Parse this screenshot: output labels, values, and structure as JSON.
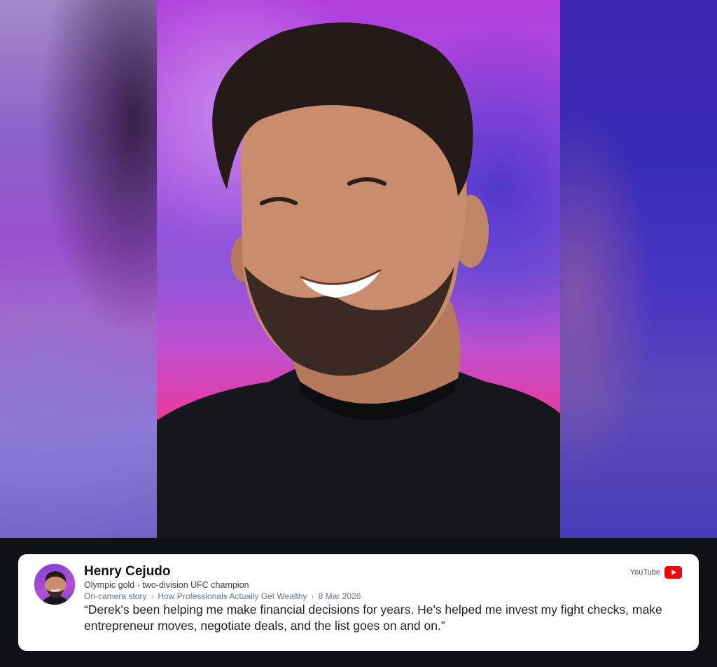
{
  "testimonial": {
    "name": "Henry Cejudo",
    "subtitle": "Olympic gold · two-division UFC champion",
    "meta": {
      "type": "On-camera story",
      "show": "How Professionals Actually Get Wealthy",
      "date": "8 Mar 2026"
    },
    "quote": "“Derek's been helping me make financial decisions for years. He's helped me invest my fight checks, make entrepreneur moves, negotiate deals, and the list goes on and on.”",
    "source": {
      "label": "YouTube",
      "icon": "youtube-icon"
    }
  },
  "colors": {
    "page_bg": "#0f1217",
    "card_bg": "#ffffff",
    "youtube_red": "#ff0000"
  }
}
